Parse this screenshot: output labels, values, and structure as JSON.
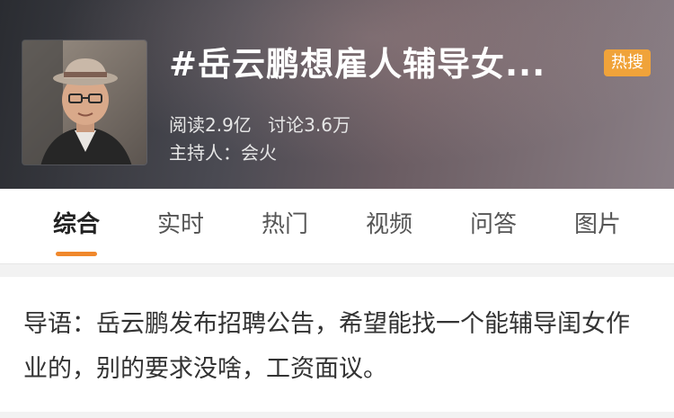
{
  "header": {
    "title": "#岳云鹏想雇人辅导女...",
    "badge": "热搜",
    "stats": {
      "reads": "阅读2.9亿",
      "discussions": "讨论3.6万"
    },
    "host": "主持人：会火",
    "colors": {
      "badge": "#f0a33a"
    }
  },
  "tabs": {
    "items": [
      "综合",
      "实时",
      "热门",
      "视频",
      "问答",
      "图片"
    ],
    "active_index": 0,
    "accent": "#f0882c"
  },
  "intro": {
    "text": "导语：岳云鹏发布招聘公告，希望能找一个能辅导闺女作业的，别的要求没啥，工资面议。"
  }
}
